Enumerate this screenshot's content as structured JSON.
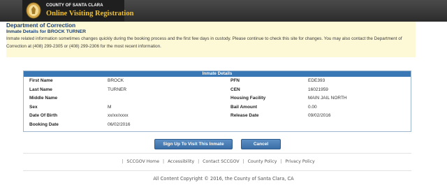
{
  "header": {
    "county": "COUNTY OF SANTA CLARA",
    "app_title": "Online Visiting Registration",
    "seal_icon": "county-seal-icon"
  },
  "notice": {
    "department": "Department of Correction",
    "inmate_for": "Inmate Details for BROCK TURNER",
    "message": "Inmate related information sometimes changes quickly during the booking process and the first few days in custody. Please continue to check this site for changes. You may also contact the Department of Correction at (408) 299-2305 or (408) 299-2306 for the most recent information."
  },
  "details": {
    "title": "Inmate Details",
    "rows": [
      {
        "l1": "First Name",
        "v1": "BROCK",
        "l2": "PFN",
        "v2": "EDE393"
      },
      {
        "l1": "Last Name",
        "v1": "TURNER",
        "l2": "CEN",
        "v2": "16021959"
      },
      {
        "l1": "Middle Name",
        "v1": "",
        "l2": "Housing Facility",
        "v2": "MAIN JAIL NORTH"
      },
      {
        "l1": "Sex",
        "v1": "M",
        "l2": "Bail Amount",
        "v2": "0.00"
      },
      {
        "l1": "Date Of Birth",
        "v1": "xx/xx/xxxx",
        "l2": "Release Date",
        "v2": "09/02/2016"
      },
      {
        "l1": "Booking Date",
        "v1": "06/02/2016",
        "l2": "",
        "v2": ""
      }
    ]
  },
  "buttons": {
    "signup": "Sign Up To Visit This Inmate",
    "cancel": "Cancel"
  },
  "footer": {
    "links": [
      "SCCGOV Home",
      "Accessibility",
      "Contact SCCGOV",
      "County Policy",
      "Privacy Policy"
    ],
    "copyright": "All Content Copyright © 2016, the County of Santa Clara, CA"
  },
  "colors": {
    "header_bg": "#2c2c2c",
    "title_gold": "#f0c030",
    "notice_bg": "#fdf8d6",
    "table_header_blue": "#3a78b5",
    "button_blue": "#3a6ea6"
  }
}
